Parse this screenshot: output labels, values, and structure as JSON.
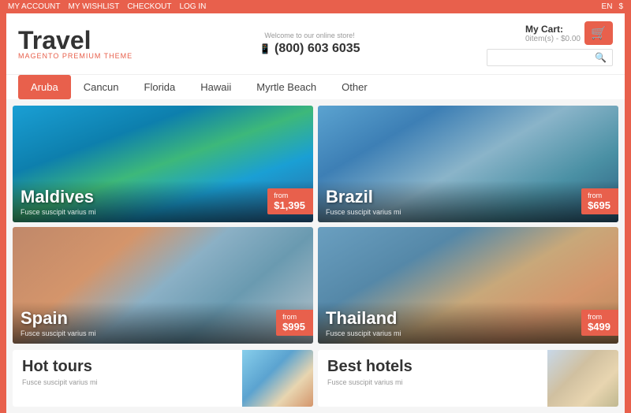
{
  "topbar": {
    "left": {
      "account": "MY ACCOUNT",
      "wishlist": "MY WISHLIST",
      "checkout": "CHECKOUT",
      "login": "LOG IN"
    },
    "right": {
      "lang": "EN",
      "currency": "$"
    }
  },
  "header": {
    "logo_title": "Travel",
    "logo_subtitle": "MAGENTO PREMIUM THEME",
    "welcome": "Welcome to our online store!",
    "phone": "(800) 603 6035",
    "search_placeholder": "",
    "cart_label": "My Cart:",
    "cart_price": "0item(s) - $0.00",
    "cart_icon": "🛒"
  },
  "nav": {
    "items": [
      {
        "label": "Aruba",
        "active": true
      },
      {
        "label": "Cancun",
        "active": false
      },
      {
        "label": "Florida",
        "active": false
      },
      {
        "label": "Hawaii",
        "active": false
      },
      {
        "label": "Myrtle Beach",
        "active": false
      },
      {
        "label": "Other",
        "active": false
      }
    ]
  },
  "tours": [
    {
      "name": "Maldives",
      "desc": "Fusce suscipit varius mi",
      "price": "$1,395",
      "bg_class": "bg-maldives"
    },
    {
      "name": "Brazil",
      "desc": "Fusce suscipit varius mi",
      "price": "$695",
      "bg_class": "bg-brazil"
    },
    {
      "name": "Spain",
      "desc": "Fusce suscipit varius mi",
      "price": "$995",
      "bg_class": "bg-spain"
    },
    {
      "name": "Thailand",
      "desc": "Fusce suscipit varius mi",
      "price": "$499",
      "bg_class": "bg-thailand"
    }
  ],
  "bottom": [
    {
      "title": "Hot tours",
      "desc": "Fusce suscipit varius mi",
      "bg_class": "bg-hot-tours"
    },
    {
      "title": "Best hotels",
      "desc": "Fusce suscipit varius mi",
      "bg_class": "bg-best-hotels"
    }
  ],
  "price_from_label": "from"
}
